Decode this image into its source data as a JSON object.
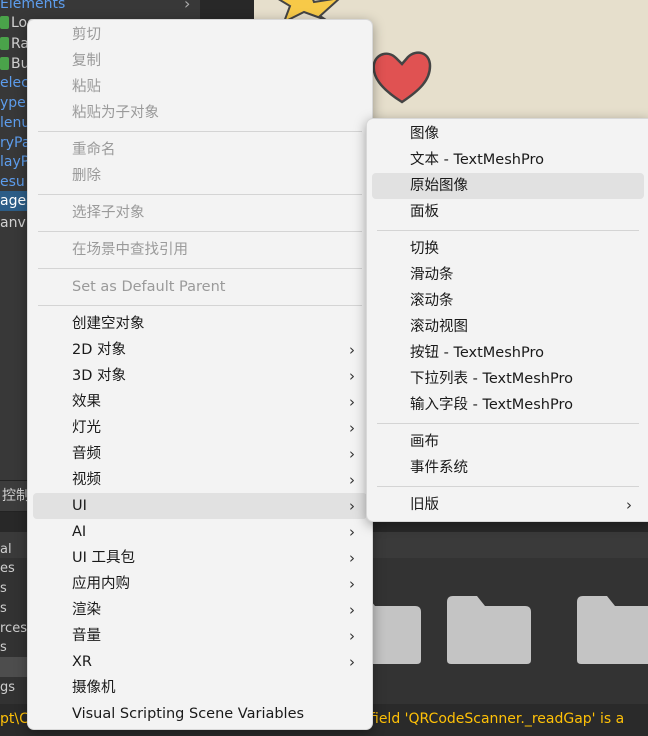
{
  "hierarchy": {
    "rows": [
      {
        "label": "Elements",
        "style": "blue",
        "icon": false
      },
      {
        "label": "Loc",
        "style": "white",
        "icon": true
      },
      {
        "label": "Ra",
        "style": "white",
        "icon": true
      },
      {
        "label": "Bu",
        "style": "white",
        "icon": true
      },
      {
        "label": "elec",
        "style": "blue",
        "icon": false
      },
      {
        "label": "ype",
        "style": "blue",
        "icon": false
      },
      {
        "label": "lenu",
        "style": "blue",
        "icon": false
      },
      {
        "label": "ryPa",
        "style": "blue",
        "icon": false
      },
      {
        "label": "layP",
        "style": "blue",
        "icon": false
      },
      {
        "label": "esu",
        "style": "blue",
        "icon": false
      },
      {
        "label": "age",
        "style": "selected",
        "icon": false
      },
      {
        "label": "anv",
        "style": "white",
        "icon": false
      }
    ]
  },
  "console": {
    "tab_label": "控制"
  },
  "project": {
    "left_items": [
      {
        "label": "al",
        "selected": false
      },
      {
        "label": "es",
        "selected": false
      },
      {
        "label": "s",
        "selected": false
      },
      {
        "label": "s",
        "selected": false
      },
      {
        "label": "rces",
        "selected": false
      },
      {
        "label": "s",
        "selected": false
      },
      {
        "label": "",
        "selected": true
      },
      {
        "label": "gs",
        "selected": false
      }
    ]
  },
  "status": {
    "left_text": "pt\\C",
    "right_text": "field 'QRCodeScanner._readGap' is a"
  },
  "context_menu": {
    "items": [
      {
        "type": "item",
        "label": "剪切",
        "disabled": true,
        "submenu": false
      },
      {
        "type": "item",
        "label": "复制",
        "disabled": true,
        "submenu": false
      },
      {
        "type": "item",
        "label": "粘贴",
        "disabled": true,
        "submenu": false
      },
      {
        "type": "item",
        "label": "粘贴为子对象",
        "disabled": true,
        "submenu": false
      },
      {
        "type": "separator"
      },
      {
        "type": "item",
        "label": "重命名",
        "disabled": true,
        "submenu": false
      },
      {
        "type": "item",
        "label": "删除",
        "disabled": true,
        "submenu": false
      },
      {
        "type": "separator"
      },
      {
        "type": "item",
        "label": "选择子对象",
        "disabled": true,
        "submenu": false
      },
      {
        "type": "separator"
      },
      {
        "type": "item",
        "label": "在场景中查找引用",
        "disabled": true,
        "submenu": false
      },
      {
        "type": "separator"
      },
      {
        "type": "item",
        "label": "Set as Default Parent",
        "disabled": true,
        "submenu": false
      },
      {
        "type": "separator"
      },
      {
        "type": "item",
        "label": "创建空对象",
        "disabled": false,
        "submenu": false
      },
      {
        "type": "item",
        "label": "2D 对象",
        "disabled": false,
        "submenu": true
      },
      {
        "type": "item",
        "label": "3D 对象",
        "disabled": false,
        "submenu": true
      },
      {
        "type": "item",
        "label": "效果",
        "disabled": false,
        "submenu": true
      },
      {
        "type": "item",
        "label": "灯光",
        "disabled": false,
        "submenu": true
      },
      {
        "type": "item",
        "label": "音频",
        "disabled": false,
        "submenu": true
      },
      {
        "type": "item",
        "label": "视频",
        "disabled": false,
        "submenu": true
      },
      {
        "type": "item",
        "label": "UI",
        "disabled": false,
        "submenu": true,
        "highlighted": true
      },
      {
        "type": "item",
        "label": "AI",
        "disabled": false,
        "submenu": true
      },
      {
        "type": "item",
        "label": "UI 工具包",
        "disabled": false,
        "submenu": true
      },
      {
        "type": "item",
        "label": "应用内购",
        "disabled": false,
        "submenu": true
      },
      {
        "type": "item",
        "label": "渲染",
        "disabled": false,
        "submenu": true
      },
      {
        "type": "item",
        "label": "音量",
        "disabled": false,
        "submenu": true
      },
      {
        "type": "item",
        "label": "XR",
        "disabled": false,
        "submenu": true
      },
      {
        "type": "item",
        "label": "摄像机",
        "disabled": false,
        "submenu": false
      },
      {
        "type": "item",
        "label": "Visual Scripting Scene Variables",
        "disabled": false,
        "submenu": false
      }
    ]
  },
  "ui_submenu": {
    "items": [
      {
        "type": "item",
        "label": "图像",
        "submenu": false
      },
      {
        "type": "item",
        "label": "文本 - TextMeshPro",
        "submenu": false
      },
      {
        "type": "item",
        "label": "原始图像",
        "submenu": false,
        "highlighted": true
      },
      {
        "type": "item",
        "label": "面板",
        "submenu": false
      },
      {
        "type": "separator"
      },
      {
        "type": "item",
        "label": "切换",
        "submenu": false
      },
      {
        "type": "item",
        "label": "滑动条",
        "submenu": false
      },
      {
        "type": "item",
        "label": "滚动条",
        "submenu": false
      },
      {
        "type": "item",
        "label": "滚动视图",
        "submenu": false
      },
      {
        "type": "item",
        "label": "按钮 - TextMeshPro",
        "submenu": false
      },
      {
        "type": "item",
        "label": "下拉列表 - TextMeshPro",
        "submenu": false
      },
      {
        "type": "item",
        "label": "输入字段 - TextMeshPro",
        "submenu": false
      },
      {
        "type": "separator"
      },
      {
        "type": "item",
        "label": "画布",
        "submenu": false
      },
      {
        "type": "item",
        "label": "事件系统",
        "submenu": false
      },
      {
        "type": "separator"
      },
      {
        "type": "item",
        "label": "旧版",
        "submenu": true
      }
    ]
  },
  "icons": {
    "submenu_arrow": "chevron-right-icon",
    "folder": "folder-icon",
    "gameobject": "gameobject-icon"
  },
  "colors": {
    "menu_bg": "#f3f3f3",
    "menu_highlight": "#e1e1e1",
    "disabled_text": "#9a9a9a",
    "hierarchy_blue": "#5d9ded",
    "warning_yellow": "#ffc107",
    "heart_red": "#e05252",
    "star_yellow": "#f7c948"
  }
}
